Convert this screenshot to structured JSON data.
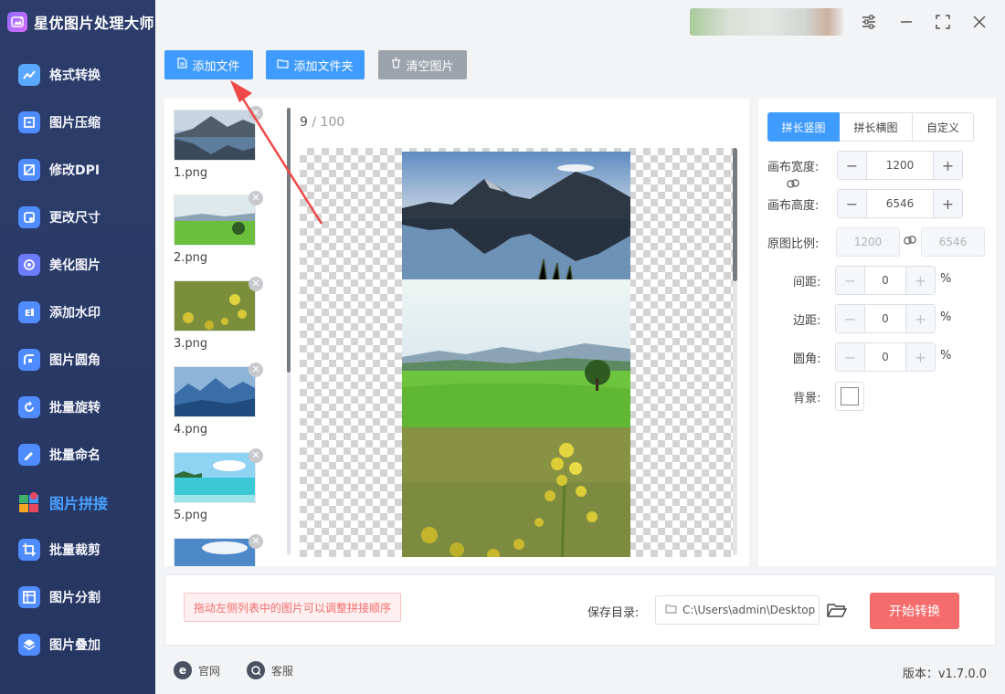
{
  "app": {
    "title": "星优图片处理大师"
  },
  "sidebar": {
    "items": [
      {
        "label": "格式转换",
        "icon": "image-convert-icon",
        "color": "#5aa8ff"
      },
      {
        "label": "图片压缩",
        "icon": "image-compress-icon",
        "color": "#4f8cff"
      },
      {
        "label": "修改DPI",
        "icon": "dpi-icon",
        "color": "#4f8cff"
      },
      {
        "label": "更改尺寸",
        "icon": "resize-icon",
        "color": "#4f8cff"
      },
      {
        "label": "美化图片",
        "icon": "beautify-icon",
        "color": "#6b7cff"
      },
      {
        "label": "添加水印",
        "icon": "watermark-icon",
        "color": "#4f8cff"
      },
      {
        "label": "图片圆角",
        "icon": "round-corner-icon",
        "color": "#4f8cff"
      },
      {
        "label": "批量旋转",
        "icon": "rotate-icon",
        "color": "#4f8cff"
      },
      {
        "label": "批量命名",
        "icon": "rename-icon",
        "color": "#4f8cff"
      },
      {
        "label": "图片拼接",
        "icon": "stitch-icon",
        "color": "#3fb06a",
        "active": true
      },
      {
        "label": "批量裁剪",
        "icon": "crop-icon",
        "color": "#4f8cff"
      },
      {
        "label": "图片分割",
        "icon": "split-icon",
        "color": "#4f8cff"
      },
      {
        "label": "图片叠加",
        "icon": "overlay-icon",
        "color": "#4f8cff"
      }
    ]
  },
  "toolbar": {
    "add_file": "添加文件",
    "add_folder": "添加文件夹",
    "clear_images": "清空图片"
  },
  "files": {
    "items": [
      {
        "name": "1.png"
      },
      {
        "name": "2.png"
      },
      {
        "name": "3.png"
      },
      {
        "name": "4.png"
      },
      {
        "name": "5.png"
      },
      {
        "name": ""
      }
    ]
  },
  "preview": {
    "current": "9",
    "separator": " / ",
    "total": "100"
  },
  "settings": {
    "tabs": [
      "拼长竖图",
      "拼长横图",
      "自定义"
    ],
    "canvas_width_label": "画布宽度:",
    "canvas_width": "1200",
    "canvas_height_label": "画布高度:",
    "canvas_height": "6546",
    "ratio_label": "原图比例:",
    "ratio_width": "1200",
    "ratio_height": "6546",
    "spacing_label": "间距:",
    "spacing": "0",
    "margin_label": "边距:",
    "margin": "0",
    "radius_label": "圆角:",
    "radius": "0",
    "percent": "%",
    "background_label": "背景:"
  },
  "bottom": {
    "tip": "拖动左侧列表中的图片可以调整拼接顺序",
    "save_label": "保存目录:",
    "save_path": "C:\\Users\\admin\\Desktop",
    "start": "开始转换"
  },
  "footer": {
    "website": "官网",
    "website_icon": "e",
    "support": "客服",
    "version": "版本：v1.7.0.0"
  },
  "colors": {
    "accent": "#3f9bff",
    "danger": "#f56c6c",
    "sidebar_bg": "#2d3d6b"
  }
}
